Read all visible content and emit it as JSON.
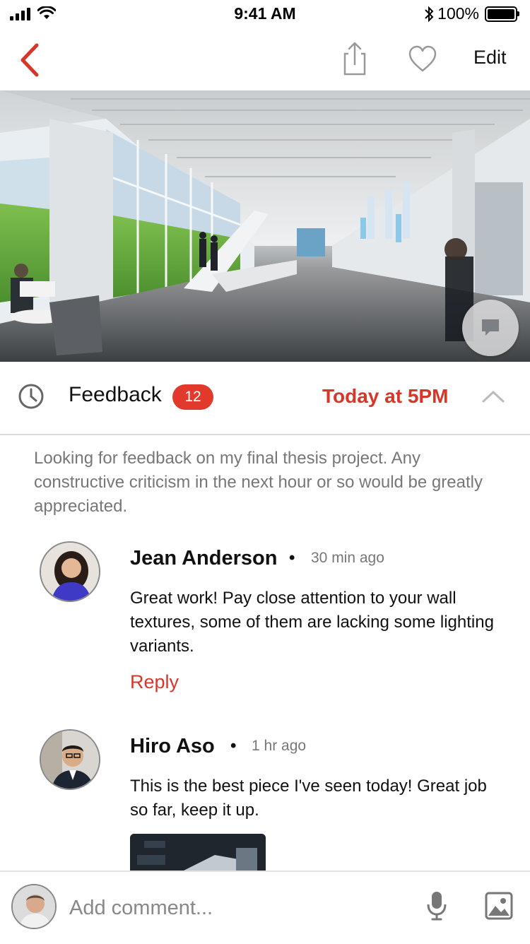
{
  "status_bar": {
    "time": "9:41 AM",
    "battery": "100%"
  },
  "nav": {
    "edit_label": "Edit"
  },
  "feedback": {
    "title": "Feedback",
    "count": "12",
    "deadline": "Today at 5PM"
  },
  "description": "Looking for feedback on my final thesis project. Any constructive criticism in the next hour or so would be greatly appreciated.",
  "comments": [
    {
      "author": "Jean Anderson",
      "time": "30 min ago",
      "text": "Great work! Pay close attention to your wall textures, some of them are lacking some lighting variants.",
      "reply_label": "Reply"
    },
    {
      "author": "Hiro Aso",
      "time": "1 hr ago",
      "text": "This is the best piece I've seen today! Great job so far, keep it up."
    }
  ],
  "composer": {
    "placeholder": "Add comment..."
  },
  "colors": {
    "accent": "#d9362a",
    "badge": "#e13a2d",
    "muted_text": "#777777",
    "divider": "#dddddd"
  }
}
